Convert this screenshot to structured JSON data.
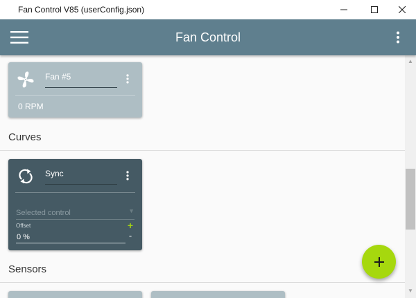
{
  "window": {
    "title": "Fan Control V85 (userConfig.json)",
    "controls": [
      "minimize-icon",
      "maximize-icon",
      "close-icon"
    ]
  },
  "appbar": {
    "title": "Fan Control",
    "menu_icon": "hamburger-menu-icon",
    "more_icon": "more-vert-icon",
    "color": "#5f7f8e"
  },
  "fan_card": {
    "icon": "fan-icon",
    "name": "Fan #5",
    "speed": "0 RPM",
    "color": "#aebec4"
  },
  "sections": {
    "curves": "Curves",
    "sensors": "Sensors"
  },
  "curve_card": {
    "icon": "sync-icon",
    "name": "Sync",
    "select_placeholder": "Selected control",
    "offset_label": "Offset",
    "offset_value": "0 %",
    "plus_label": "+",
    "minus_label": "-",
    "color": "#455a64"
  },
  "fab": {
    "icon": "plus-icon",
    "color": "#a6d80e"
  }
}
